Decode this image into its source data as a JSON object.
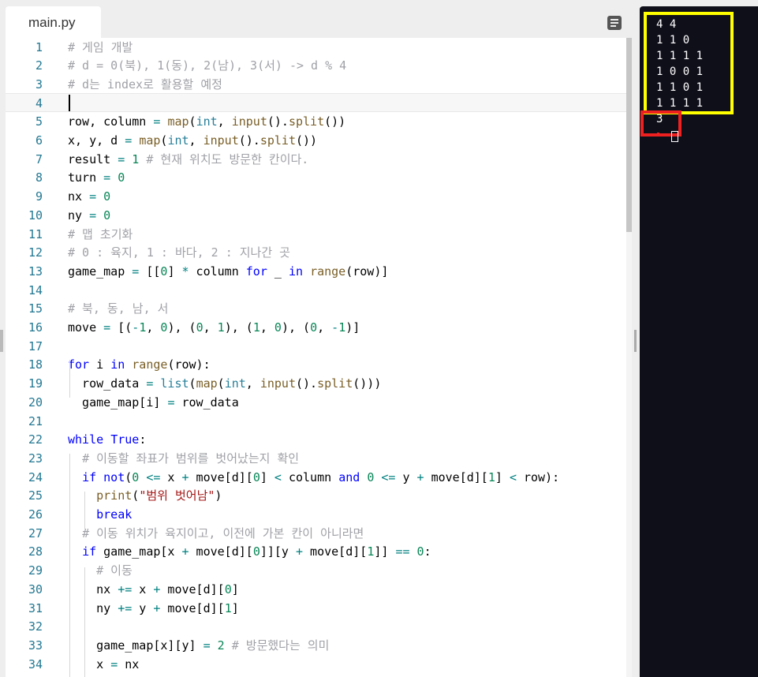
{
  "editor": {
    "tab_label": "main.py",
    "menu_icon": "hamburger-menu-icon",
    "current_line": 4,
    "lines": [
      [
        [
          "c",
          "# 게임 개발"
        ]
      ],
      [
        [
          "c",
          "# d = 0(북), 1(동), 2(남), 3(서) -> d % 4"
        ]
      ],
      [
        [
          "c",
          "# d는 index로 활용할 예정"
        ]
      ],
      [],
      [
        [
          "",
          "row, column "
        ],
        [
          "o",
          "="
        ],
        [
          "",
          " "
        ],
        [
          "f",
          "map"
        ],
        [
          "",
          "("
        ],
        [
          "b",
          "int"
        ],
        [
          "",
          ", "
        ],
        [
          "f",
          "input"
        ],
        [
          "",
          "()."
        ],
        [
          "f",
          "split"
        ],
        [
          "",
          "())"
        ]
      ],
      [
        [
          "",
          "x, y, d "
        ],
        [
          "o",
          "="
        ],
        [
          "",
          " "
        ],
        [
          "f",
          "map"
        ],
        [
          "",
          "("
        ],
        [
          "b",
          "int"
        ],
        [
          "",
          ", "
        ],
        [
          "f",
          "input"
        ],
        [
          "",
          "()."
        ],
        [
          "f",
          "split"
        ],
        [
          "",
          "())"
        ]
      ],
      [
        [
          "",
          "result "
        ],
        [
          "o",
          "="
        ],
        [
          "",
          " "
        ],
        [
          "n",
          "1"
        ],
        [
          "",
          " "
        ],
        [
          "c",
          "# 현재 위치도 방문한 칸이다."
        ]
      ],
      [
        [
          "",
          "turn "
        ],
        [
          "o",
          "="
        ],
        [
          "",
          " "
        ],
        [
          "n",
          "0"
        ]
      ],
      [
        [
          "",
          "nx "
        ],
        [
          "o",
          "="
        ],
        [
          "",
          " "
        ],
        [
          "n",
          "0"
        ]
      ],
      [
        [
          "",
          "ny "
        ],
        [
          "o",
          "="
        ],
        [
          "",
          " "
        ],
        [
          "n",
          "0"
        ]
      ],
      [
        [
          "c",
          "# 맵 초기화"
        ]
      ],
      [
        [
          "c",
          "# 0 : 육지, 1 : 바다, 2 : 지나간 곳"
        ]
      ],
      [
        [
          "",
          "game_map "
        ],
        [
          "o",
          "="
        ],
        [
          "",
          " [["
        ],
        [
          "n",
          "0"
        ],
        [
          "",
          "] "
        ],
        [
          "o",
          "*"
        ],
        [
          "",
          " column "
        ],
        [
          "k",
          "for"
        ],
        [
          "",
          " _ "
        ],
        [
          "k",
          "in"
        ],
        [
          "",
          " "
        ],
        [
          "f",
          "range"
        ],
        [
          "",
          "(row)]"
        ]
      ],
      [],
      [
        [
          "c",
          "# 북, 동, 남, 서"
        ]
      ],
      [
        [
          "",
          "move "
        ],
        [
          "o",
          "="
        ],
        [
          "",
          " [("
        ],
        [
          "o",
          "-"
        ],
        [
          "n",
          "1"
        ],
        [
          "",
          ", "
        ],
        [
          "n",
          "0"
        ],
        [
          "",
          "), ("
        ],
        [
          "n",
          "0"
        ],
        [
          "",
          ", "
        ],
        [
          "n",
          "1"
        ],
        [
          "",
          "), ("
        ],
        [
          "n",
          "1"
        ],
        [
          "",
          ", "
        ],
        [
          "n",
          "0"
        ],
        [
          "",
          "), ("
        ],
        [
          "n",
          "0"
        ],
        [
          "",
          ", "
        ],
        [
          "o",
          "-"
        ],
        [
          "n",
          "1"
        ],
        [
          "",
          ")]"
        ]
      ],
      [],
      [
        [
          "k",
          "for"
        ],
        [
          "",
          " i "
        ],
        [
          "k",
          "in"
        ],
        [
          "",
          " "
        ],
        [
          "f",
          "range"
        ],
        [
          "",
          "(row):"
        ]
      ],
      [
        [
          "",
          "  row_data "
        ],
        [
          "o",
          "="
        ],
        [
          "",
          " "
        ],
        [
          "b",
          "list"
        ],
        [
          "",
          "("
        ],
        [
          "f",
          "map"
        ],
        [
          "",
          "("
        ],
        [
          "b",
          "int"
        ],
        [
          "",
          ", "
        ],
        [
          "f",
          "input"
        ],
        [
          "",
          "()."
        ],
        [
          "f",
          "split"
        ],
        [
          "",
          "()))"
        ]
      ],
      [
        [
          "",
          "  game_map[i] "
        ],
        [
          "o",
          "="
        ],
        [
          "",
          " row_data"
        ]
      ],
      [],
      [
        [
          "k",
          "while"
        ],
        [
          "",
          " "
        ],
        [
          "k",
          "True"
        ],
        [
          "",
          ":"
        ]
      ],
      [
        [
          "",
          "  "
        ],
        [
          "c",
          "# 이동할 좌표가 범위를 벗어났는지 확인"
        ]
      ],
      [
        [
          "",
          "  "
        ],
        [
          "k",
          "if"
        ],
        [
          "",
          " "
        ],
        [
          "k",
          "not"
        ],
        [
          "",
          "("
        ],
        [
          "n",
          "0"
        ],
        [
          "",
          " "
        ],
        [
          "o",
          "<="
        ],
        [
          "",
          " x "
        ],
        [
          "o",
          "+"
        ],
        [
          "",
          " move[d]["
        ],
        [
          "n",
          "0"
        ],
        [
          "",
          "] "
        ],
        [
          "o",
          "<"
        ],
        [
          "",
          " column "
        ],
        [
          "k",
          "and"
        ],
        [
          "",
          " "
        ],
        [
          "n",
          "0"
        ],
        [
          "",
          " "
        ],
        [
          "o",
          "<="
        ],
        [
          "",
          " y "
        ],
        [
          "o",
          "+"
        ],
        [
          "",
          " move[d]["
        ],
        [
          "n",
          "1"
        ],
        [
          "",
          "] "
        ],
        [
          "o",
          "<"
        ],
        [
          "",
          " row):"
        ]
      ],
      [
        [
          "",
          "    "
        ],
        [
          "f",
          "print"
        ],
        [
          "",
          "("
        ],
        [
          "s",
          "\"범위 벗어남\""
        ],
        [
          "",
          ")"
        ]
      ],
      [
        [
          "",
          "    "
        ],
        [
          "k",
          "break"
        ]
      ],
      [
        [
          "",
          "  "
        ],
        [
          "c",
          "# 이동 위치가 육지이고, 이전에 가본 칸이 아니라면"
        ]
      ],
      [
        [
          "",
          "  "
        ],
        [
          "k",
          "if"
        ],
        [
          "",
          " game_map[x "
        ],
        [
          "o",
          "+"
        ],
        [
          "",
          " move[d]["
        ],
        [
          "n",
          "0"
        ],
        [
          "",
          "]][y "
        ],
        [
          "o",
          "+"
        ],
        [
          "",
          " move[d]["
        ],
        [
          "n",
          "1"
        ],
        [
          "",
          "]] "
        ],
        [
          "o",
          "=="
        ],
        [
          "",
          " "
        ],
        [
          "n",
          "0"
        ],
        [
          "",
          ":"
        ]
      ],
      [
        [
          "",
          "    "
        ],
        [
          "c",
          "# 이동"
        ]
      ],
      [
        [
          "",
          "    nx "
        ],
        [
          "o",
          "+="
        ],
        [
          "",
          " x "
        ],
        [
          "o",
          "+"
        ],
        [
          "",
          " move[d]["
        ],
        [
          "n",
          "0"
        ],
        [
          "",
          "]"
        ]
      ],
      [
        [
          "",
          "    ny "
        ],
        [
          "o",
          "+="
        ],
        [
          "",
          " y "
        ],
        [
          "o",
          "+"
        ],
        [
          "",
          " move[d]["
        ],
        [
          "n",
          "1"
        ],
        [
          "",
          "]"
        ]
      ],
      [],
      [
        [
          "",
          "    game_map[x][y] "
        ],
        [
          "o",
          "="
        ],
        [
          "",
          " "
        ],
        [
          "n",
          "2"
        ],
        [
          "",
          " "
        ],
        [
          "c",
          "# 방문했다는 의미"
        ]
      ],
      [
        [
          "",
          "    x "
        ],
        [
          "o",
          "="
        ],
        [
          "",
          " nx"
        ]
      ]
    ]
  },
  "console": {
    "lines": [
      "4 4",
      "1 1 0",
      "1 1 1 1",
      "1 0 0 1",
      "1 1 0 1",
      "1 1 1 1",
      "3"
    ],
    "highlight_input_color": "#ffff00",
    "highlight_result_color": "#ee2020"
  }
}
